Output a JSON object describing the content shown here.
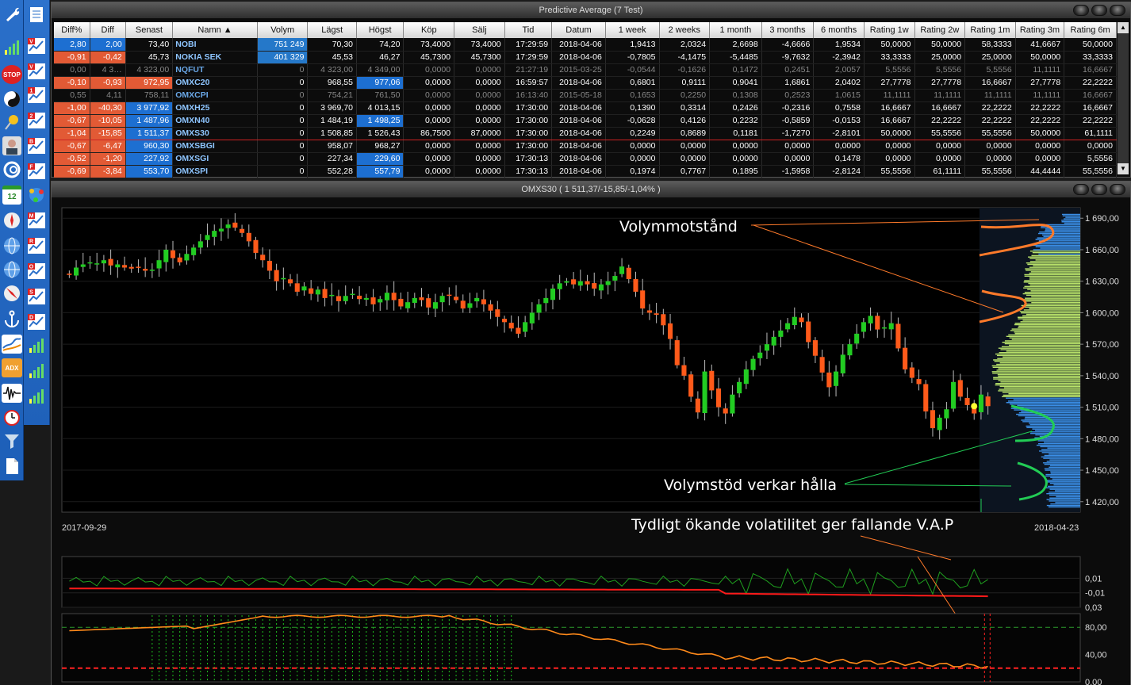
{
  "app": {
    "table_panel_title": "Predictive Average (7  Test)",
    "chart_panel_title": "OMXS30 ( 1 511,37/-15,85/-1,04% )"
  },
  "toolbar_left": [
    "wrench-icon",
    "chart-bars-icon",
    "stop-icon",
    "yin-yang-icon",
    "pin-icon",
    "person-icon",
    "swirl-icon",
    "calendar-icon",
    "compass-icon",
    "globe-icon",
    "globe-icon",
    "compass-icon",
    "anchor-icon",
    "line-chart-icon",
    "adx-icon",
    "waveform-icon",
    "alarm-clock-icon",
    "filter-icon",
    "document-icon"
  ],
  "toolbar_left_labels": {
    "stop": "STOP",
    "calendar": "12",
    "adx": "ADX"
  },
  "toolbar_right_letters": [
    "",
    "V",
    "V",
    "1",
    "2",
    "B",
    "F",
    "",
    "M",
    "R",
    "O",
    "S",
    "D",
    "",
    "",
    ""
  ],
  "table": {
    "columns": [
      "Diff%",
      "Diff",
      "Senast",
      "Namn",
      "Volym",
      "Lägst",
      "Högst",
      "Köp",
      "Sälj",
      "Tid",
      "Datum",
      "1 week",
      "2 weeks",
      "1 month",
      "3 months",
      "6 months",
      "Rating 1w",
      "Rating 2w",
      "Rating 1m",
      "Rating 3m",
      "Rating 6m"
    ],
    "rows": [
      [
        "2,80",
        "2,00",
        "73,40",
        "NOBI",
        "751 249",
        "70,30",
        "74,20",
        "73,4000",
        "73,4000",
        "17:29:59",
        "2018-04-06",
        "1,9413",
        "2,0324",
        "2,6698",
        "-4,6666",
        "1,9534",
        "50,0000",
        "50,0000",
        "58,3333",
        "41,6667",
        "50,0000"
      ],
      [
        "-0,91",
        "-0,42",
        "45,73",
        "NOKIA SEK",
        "401 329",
        "45,53",
        "46,27",
        "45,7300",
        "45,7300",
        "17:29:59",
        "2018-04-06",
        "-0,7805",
        "-4,1475",
        "-5,4485",
        "-9,7632",
        "-2,3942",
        "33,3333",
        "25,0000",
        "25,0000",
        "50,0000",
        "33,3333"
      ],
      [
        "0,00",
        "4 3…",
        "4 323,00",
        "NQFUT",
        "0",
        "4 323,00",
        "4 349,00",
        "0,0000",
        "0,0000",
        "21:27:19",
        "2015-03-25",
        "-0,0544",
        "-0,1626",
        "0,1472",
        "0,2451",
        "2,0057",
        "5,5556",
        "5,5556",
        "5,5556",
        "11,1111",
        "16,6667"
      ],
      [
        "-0,10",
        "-0,93",
        "972,95",
        "OMXC20",
        "0",
        "968,55",
        "977,06",
        "0,0000",
        "0,0000",
        "16:59:57",
        "2018-04-06",
        "0,6801",
        "0,9111",
        "0,9041",
        "1,6861",
        "2,0402",
        "27,7778",
        "27,7778",
        "16,6667",
        "27,7778",
        "22,2222"
      ],
      [
        "0,55",
        "4,11",
        "758,11",
        "OMXCPI",
        "0",
        "754,21",
        "761,50",
        "0,0000",
        "0,0000",
        "16:13:40",
        "2015-05-18",
        "0,1653",
        "0,2250",
        "0,1308",
        "0,2523",
        "1,0615",
        "11,1111",
        "11,1111",
        "11,1111",
        "11,1111",
        "16,6667"
      ],
      [
        "-1,00",
        "-40,30",
        "3 977,92",
        "OMXH25",
        "0",
        "3 969,70",
        "4 013,15",
        "0,0000",
        "0,0000",
        "17:30:00",
        "2018-04-06",
        "0,1390",
        "0,3314",
        "0,2426",
        "-0,2316",
        "0,7558",
        "16,6667",
        "16,6667",
        "22,2222",
        "22,2222",
        "16,6667"
      ],
      [
        "-0,67",
        "-10,05",
        "1 487,96",
        "OMXN40",
        "0",
        "1 484,19",
        "1 498,25",
        "0,0000",
        "0,0000",
        "17:30:00",
        "2018-04-06",
        "-0,0628",
        "0,4126",
        "0,2232",
        "-0,5859",
        "-0,0153",
        "16,6667",
        "22,2222",
        "22,2222",
        "22,2222",
        "22,2222"
      ],
      [
        "-1,04",
        "-15,85",
        "1 511,37",
        "OMXS30",
        "0",
        "1 508,85",
        "1 526,43",
        "86,7500",
        "87,0000",
        "17:30:00",
        "2018-04-06",
        "0,2249",
        "0,8689",
        "0,1181",
        "-1,7270",
        "-2,8101",
        "50,0000",
        "55,5556",
        "55,5556",
        "50,0000",
        "61,1111"
      ],
      [
        "-0,67",
        "-6,47",
        "960,30",
        "OMXSBGI",
        "0",
        "958,07",
        "968,27",
        "0,0000",
        "0,0000",
        "17:30:00",
        "2018-04-06",
        "0,0000",
        "0,0000",
        "0,0000",
        "0,0000",
        "0,0000",
        "0,0000",
        "0,0000",
        "0,0000",
        "0,0000",
        "0,0000"
      ],
      [
        "-0,52",
        "-1,20",
        "227,92",
        "OMXSGI",
        "0",
        "227,34",
        "229,60",
        "0,0000",
        "0,0000",
        "17:30:13",
        "2018-04-06",
        "0,0000",
        "0,0000",
        "0,0000",
        "0,0000",
        "0,1478",
        "0,0000",
        "0,0000",
        "0,0000",
        "0,0000",
        "5,5556"
      ],
      [
        "-0,69",
        "-3,84",
        "553,70",
        "OMXSPI",
        "0",
        "552,28",
        "557,79",
        "0,0000",
        "0,0000",
        "17:30:13",
        "2018-04-06",
        "0,1974",
        "0,7767",
        "0,1895",
        "-1,5958",
        "-2,8124",
        "55,5556",
        "61,1111",
        "55,5556",
        "44,4444",
        "55,5556"
      ]
    ],
    "cell_styles": [
      [
        "pos",
        "pos",
        "",
        "",
        "vol",
        "",
        "",
        "",
        "",
        "",
        "",
        "",
        "",
        "",
        "",
        "",
        "",
        "",
        "",
        "",
        ""
      ],
      [
        "neg",
        "neg",
        "",
        "",
        "vol",
        "",
        "",
        "",
        "",
        "",
        "",
        "",
        "",
        "",
        "",
        "",
        "",
        "",
        "",
        "",
        ""
      ],
      [
        "",
        "",
        "",
        "",
        "",
        "",
        "",
        "",
        "",
        "",
        "",
        "",
        "",
        "",
        "",
        "",
        "",
        "",
        "",
        "",
        ""
      ],
      [
        "neg",
        "neg",
        "neg",
        "",
        "",
        "",
        "pos",
        "",
        "",
        "",
        "",
        "",
        "",
        "",
        "",
        "",
        "",
        "",
        "",
        "",
        ""
      ],
      [
        "",
        "",
        "",
        "",
        "",
        "",
        "",
        "",
        "",
        "",
        "",
        "",
        "",
        "",
        "",
        "",
        "",
        "",
        "",
        "",
        ""
      ],
      [
        "neg",
        "neg",
        "pos",
        "",
        "",
        "",
        "",
        "",
        "",
        "",
        "",
        "",
        "",
        "",
        "",
        "",
        "",
        "",
        "",
        "",
        ""
      ],
      [
        "neg",
        "neg",
        "pos",
        "",
        "",
        "",
        "pos",
        "",
        "",
        "",
        "",
        "",
        "",
        "",
        "",
        "",
        "",
        "",
        "",
        "",
        ""
      ],
      [
        "neg",
        "neg",
        "pos",
        "",
        "",
        "",
        "",
        "",
        "",
        "",
        "",
        "",
        "",
        "",
        "",
        "",
        "",
        "",
        "",
        "",
        ""
      ],
      [
        "neg",
        "neg",
        "pos",
        "",
        "",
        "",
        "",
        "",
        "",
        "",
        "",
        "",
        "",
        "",
        "",
        "",
        "",
        "",
        "",
        "",
        ""
      ],
      [
        "neg",
        "neg",
        "pos",
        "",
        "",
        "",
        "pos",
        "",
        "",
        "",
        "",
        "",
        "",
        "",
        "",
        "",
        "",
        "",
        "",
        "",
        ""
      ],
      [
        "neg",
        "neg",
        "pos",
        "",
        "",
        "",
        "pos",
        "",
        "",
        "",
        "",
        "",
        "",
        "",
        "",
        "",
        "",
        "",
        "",
        "",
        ""
      ]
    ],
    "dim_rows": [
      2,
      4
    ],
    "selected_row": 7
  },
  "chart_data": {
    "type": "candlestick",
    "title": "OMXS30 ( 1 511,37/-15,85/-1,04% )",
    "x_start": "2017-09-29",
    "x_end": "2018-04-23",
    "ylim": [
      1410,
      1700
    ],
    "y_ticks": [
      "1 690,00",
      "1 660,00",
      "1 630,00",
      "1 600,00",
      "1 570,00",
      "1 540,00",
      "1 510,00",
      "1 480,00",
      "1 450,00",
      "1 420,00"
    ],
    "y_tick_values": [
      1690,
      1660,
      1630,
      1600,
      1570,
      1540,
      1510,
      1480,
      1450,
      1420
    ],
    "closes": [
      1636,
      1643,
      1646,
      1648,
      1647,
      1650,
      1645,
      1646,
      1643,
      1642,
      1643,
      1640,
      1641,
      1650,
      1660,
      1652,
      1648,
      1656,
      1662,
      1668,
      1674,
      1678,
      1680,
      1684,
      1681,
      1676,
      1668,
      1657,
      1650,
      1640,
      1630,
      1633,
      1628,
      1620,
      1625,
      1618,
      1622,
      1614,
      1617,
      1611,
      1616,
      1618,
      1613,
      1614,
      1608,
      1613,
      1619,
      1612,
      1606,
      1610,
      1614,
      1612,
      1605,
      1610,
      1616,
      1617,
      1612,
      1604,
      1609,
      1614,
      1608,
      1602,
      1596,
      1591,
      1585,
      1580,
      1591,
      1600,
      1608,
      1614,
      1623,
      1628,
      1630,
      1627,
      1630,
      1627,
      1623,
      1627,
      1630,
      1635,
      1644,
      1632,
      1620,
      1604,
      1600,
      1598,
      1588,
      1575,
      1550,
      1540,
      1520,
      1505,
      1544,
      1526,
      1510,
      1504,
      1522,
      1534,
      1546,
      1556,
      1562,
      1570,
      1577,
      1583,
      1590,
      1596,
      1591,
      1572,
      1559,
      1543,
      1529,
      1544,
      1560,
      1570,
      1580,
      1591,
      1597,
      1584,
      1586,
      1590,
      1566,
      1546,
      1538,
      1532,
      1506,
      1490,
      1500,
      1508,
      1534,
      1520,
      1512,
      1504,
      1522,
      1511
    ],
    "volume_profile_note": "volume at price histogram on right edge",
    "indicator1": {
      "y_ticks": [
        "0,01",
        "-0,01",
        "0,03"
      ],
      "y_tick_values": [
        0.01,
        -0.01,
        -0.03
      ],
      "ylim": [
        -0.03,
        0.04
      ]
    },
    "indicator2": {
      "y_ticks": [
        "80,00",
        "40,00",
        "0,00"
      ],
      "y_tick_values": [
        80,
        40,
        0
      ],
      "ylim": [
        0,
        100
      ],
      "upper_line": 80,
      "lower_line": 20
    },
    "annotations": {
      "resistance": "Volymmotstånd",
      "support": "Volymstöd verkar hålla",
      "volatility": "Tydligt ökande volatilitet ger fallande V.A.P"
    },
    "colors": {
      "up": "#22cc22",
      "down": "#ff5a1a",
      "vap": "#3a8ee6",
      "annotation_orange": "#ff7a2a",
      "annotation_green": "#22cc55"
    }
  }
}
